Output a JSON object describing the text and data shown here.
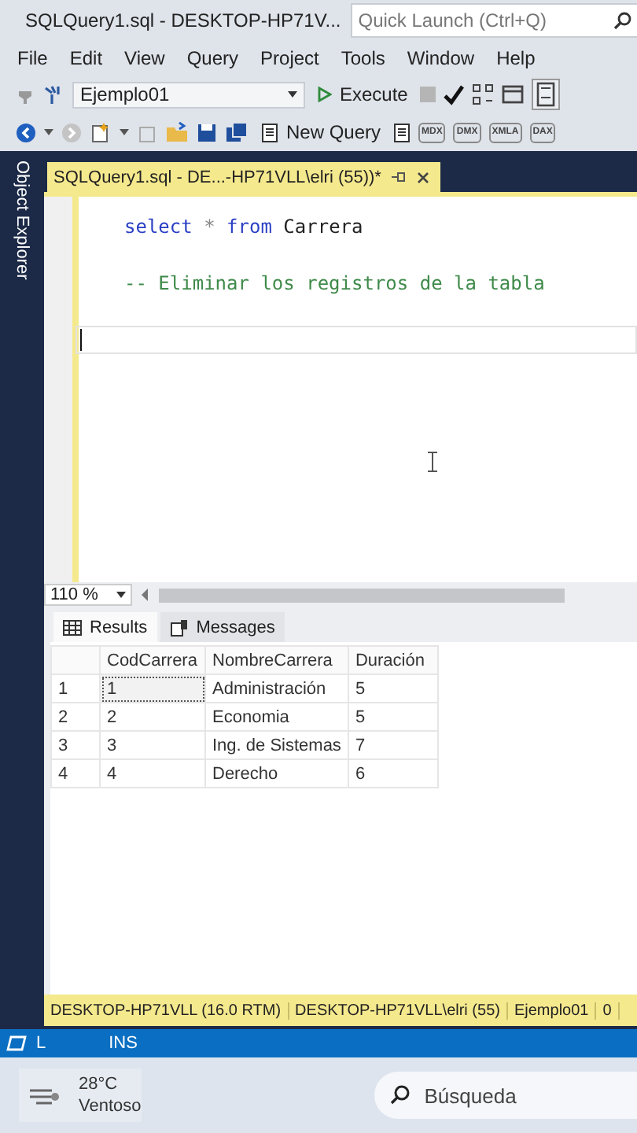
{
  "window": {
    "title": "SQLQuery1.sql - DESKTOP-HP71V...",
    "quick_launch": {
      "placeholder": "Quick Launch (Ctrl+Q)"
    }
  },
  "menu": [
    "File",
    "Edit",
    "View",
    "Query",
    "Project",
    "Tools",
    "Window",
    "Help"
  ],
  "toolbar": {
    "database": "Ejemplo01",
    "execute": "Execute",
    "new_query": "New Query",
    "query_types": [
      "MDX",
      "DMX",
      "XMLA",
      "DAX"
    ]
  },
  "sidebar": {
    "label": "Object Explorer"
  },
  "document_tab": {
    "title": "SQLQuery1.sql - DE...-HP71VLL\\elri (55))*",
    "selected": true
  },
  "editor": {
    "lines": [
      {
        "tokens": [
          {
            "kind": "keyword",
            "text": "select"
          },
          {
            "kind": "operator",
            "text": " * "
          },
          {
            "kind": "keyword",
            "text": "from"
          },
          {
            "kind": "plain",
            "text": " Carrera"
          }
        ],
        "current": false
      },
      {
        "current": false
      },
      {
        "tokens": [
          {
            "kind": "comment",
            "text": "-- Eliminar los registros de la tabla"
          }
        ],
        "current": false
      },
      {
        "current": false
      },
      {
        "current": true
      }
    ]
  },
  "zoom": "110 %",
  "result_tabs": [
    {
      "label": "Results",
      "selected": true
    },
    {
      "label": "Messages",
      "selected": false
    }
  ],
  "grid": {
    "columns": [
      "CodCarrera",
      "NombreCarrera",
      "Duración"
    ],
    "rows": [
      {
        "number": "1",
        "cells": [
          "1",
          "Administración",
          "5"
        ],
        "focused": true
      },
      {
        "number": "2",
        "cells": [
          "2",
          "Economia",
          "5"
        ],
        "focused": false
      },
      {
        "number": "3",
        "cells": [
          "3",
          "Ing. de Sistemas",
          "7"
        ],
        "focused": false
      },
      {
        "number": "4",
        "cells": [
          "4",
          "Derecho",
          "6"
        ],
        "focused": false
      }
    ]
  },
  "query_status": [
    "DESKTOP-HP71VLL (16.0 RTM)",
    "DESKTOP-HP71VLL\\elri (55)",
    "Ejemplo01",
    "0"
  ],
  "status_bar": {
    "line": "L",
    "mode": "INS"
  },
  "taskbar": {
    "temperature": "28°C",
    "weather": "Ventoso",
    "search": {
      "placeholder": "Búsqueda"
    }
  }
}
